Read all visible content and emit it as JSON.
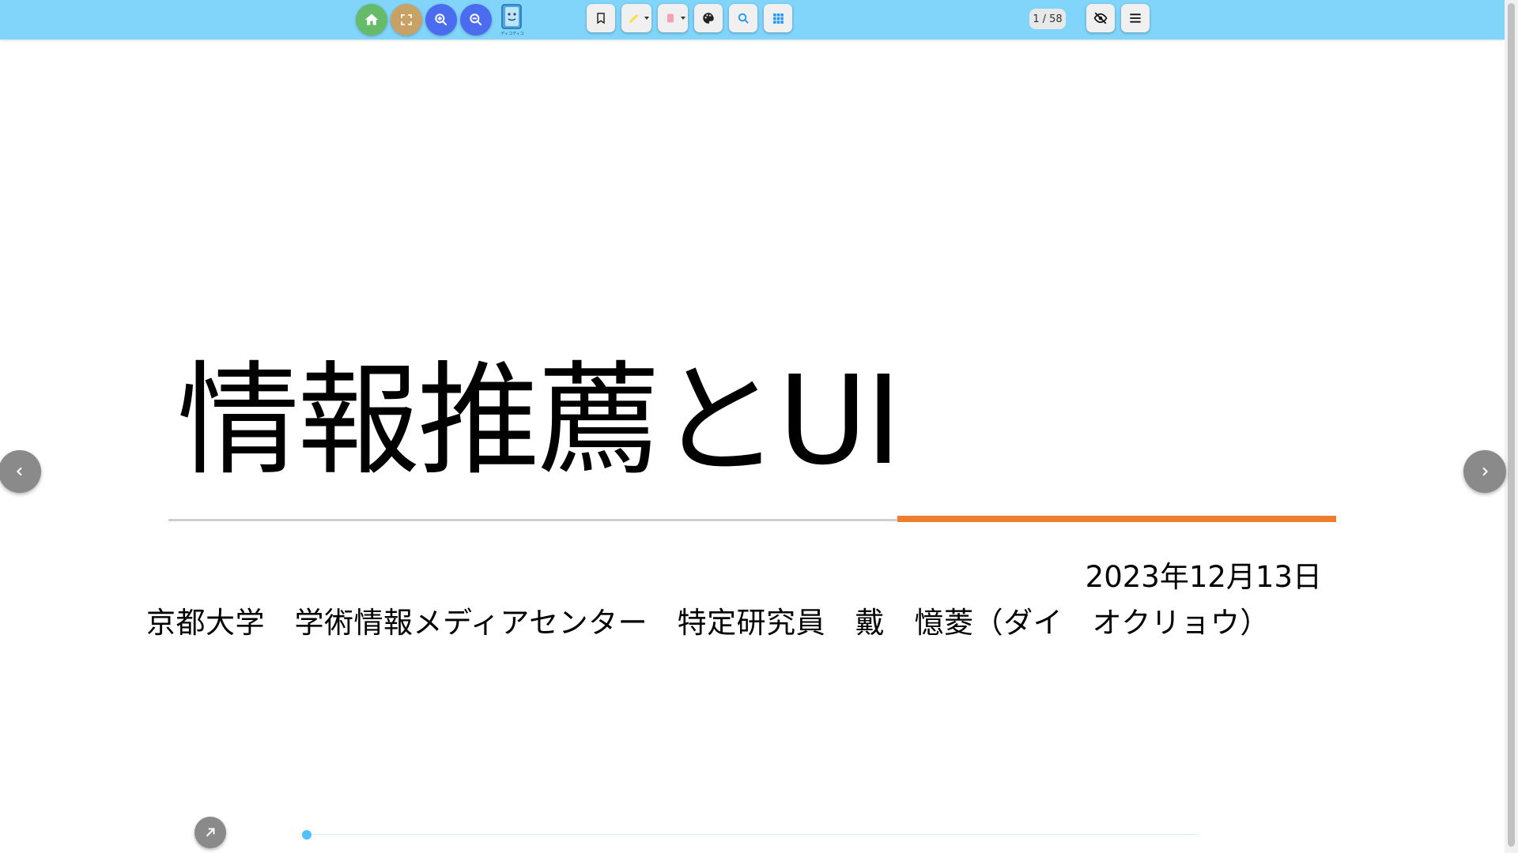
{
  "toolbar": {
    "background": "#81d4fa",
    "buttons": [
      {
        "id": "home",
        "icon": "home-icon",
        "color": "#66bb6a"
      },
      {
        "id": "fullscreen",
        "icon": "fullscreen-icon",
        "color": "#c8a165"
      },
      {
        "id": "zoom-in",
        "icon": "zoom-in-icon",
        "color": "#4c6cf0"
      },
      {
        "id": "zoom-out",
        "icon": "zoom-out-icon",
        "color": "#4c6cf0"
      },
      {
        "id": "bookmark",
        "icon": "bookmark-icon"
      },
      {
        "id": "highlighter",
        "icon": "highlighter-icon",
        "color": "#f5e04a"
      },
      {
        "id": "eraser",
        "icon": "eraser-icon",
        "color": "#f4a3b4"
      },
      {
        "id": "palette",
        "icon": "palette-icon"
      },
      {
        "id": "search",
        "icon": "search-icon",
        "color": "#2196f3"
      },
      {
        "id": "thumbnails",
        "icon": "grid-icon",
        "color": "#2196f3"
      },
      {
        "id": "hide",
        "icon": "eye-off-icon"
      },
      {
        "id": "menu",
        "icon": "hamburger-menu-icon"
      }
    ],
    "logo_icon": "book-mascot-logo",
    "page": {
      "current": "1",
      "separator": "/",
      "total": "58"
    }
  },
  "slide": {
    "title": "情報推薦とUI",
    "date": "2023年12月13日",
    "author": "京都大学　学術情報メディアセンター　特定研究員　戴　憶菱（ダイ　オクリョウ）",
    "accent_color": "#ed7d31"
  },
  "navigation": {
    "prev_icon": "chevron-left-icon",
    "next_icon": "chevron-right-icon",
    "expand_icon": "arrow-up-right-icon",
    "progress": 0.0
  }
}
